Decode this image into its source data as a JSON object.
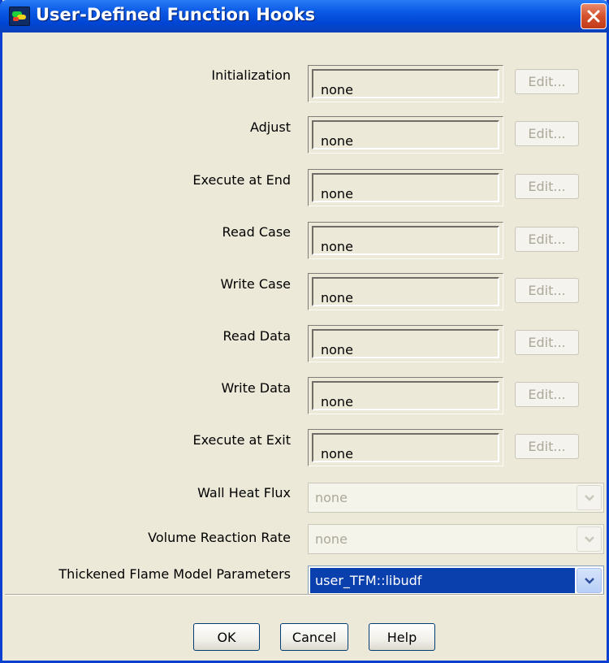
{
  "window": {
    "title": "User-Defined Function Hooks",
    "app_icon": "fluent-app-icon",
    "close_icon": "close-icon"
  },
  "hooks": [
    {
      "label": "Initialization",
      "value": "none",
      "edit_label": "Edit...",
      "edit_enabled": false
    },
    {
      "label": "Adjust",
      "value": "none",
      "edit_label": "Edit...",
      "edit_enabled": false
    },
    {
      "label": "Execute at End",
      "value": "none",
      "edit_label": "Edit...",
      "edit_enabled": false
    },
    {
      "label": "Read Case",
      "value": "none",
      "edit_label": "Edit...",
      "edit_enabled": false
    },
    {
      "label": "Write Case",
      "value": "none",
      "edit_label": "Edit...",
      "edit_enabled": false
    },
    {
      "label": "Read Data",
      "value": "none",
      "edit_label": "Edit...",
      "edit_enabled": false
    },
    {
      "label": "Write Data",
      "value": "none",
      "edit_label": "Edit...",
      "edit_enabled": false
    },
    {
      "label": "Execute at Exit",
      "value": "none",
      "edit_label": "Edit...",
      "edit_enabled": false
    }
  ],
  "dropdowns": [
    {
      "label": "Wall Heat Flux",
      "value": "none",
      "enabled": false
    },
    {
      "label": "Volume Reaction Rate",
      "value": "none",
      "enabled": false
    },
    {
      "label": "Thickened Flame Model Parameters",
      "value": "user_TFM::libudf",
      "enabled": true
    }
  ],
  "buttons": {
    "ok": "OK",
    "cancel": "Cancel",
    "help": "Help"
  },
  "colors": {
    "titlebar": "#0b5ae6",
    "dialog_bg": "#ece9d8",
    "selection": "#0a3fae",
    "disabled_text": "#aca899"
  }
}
